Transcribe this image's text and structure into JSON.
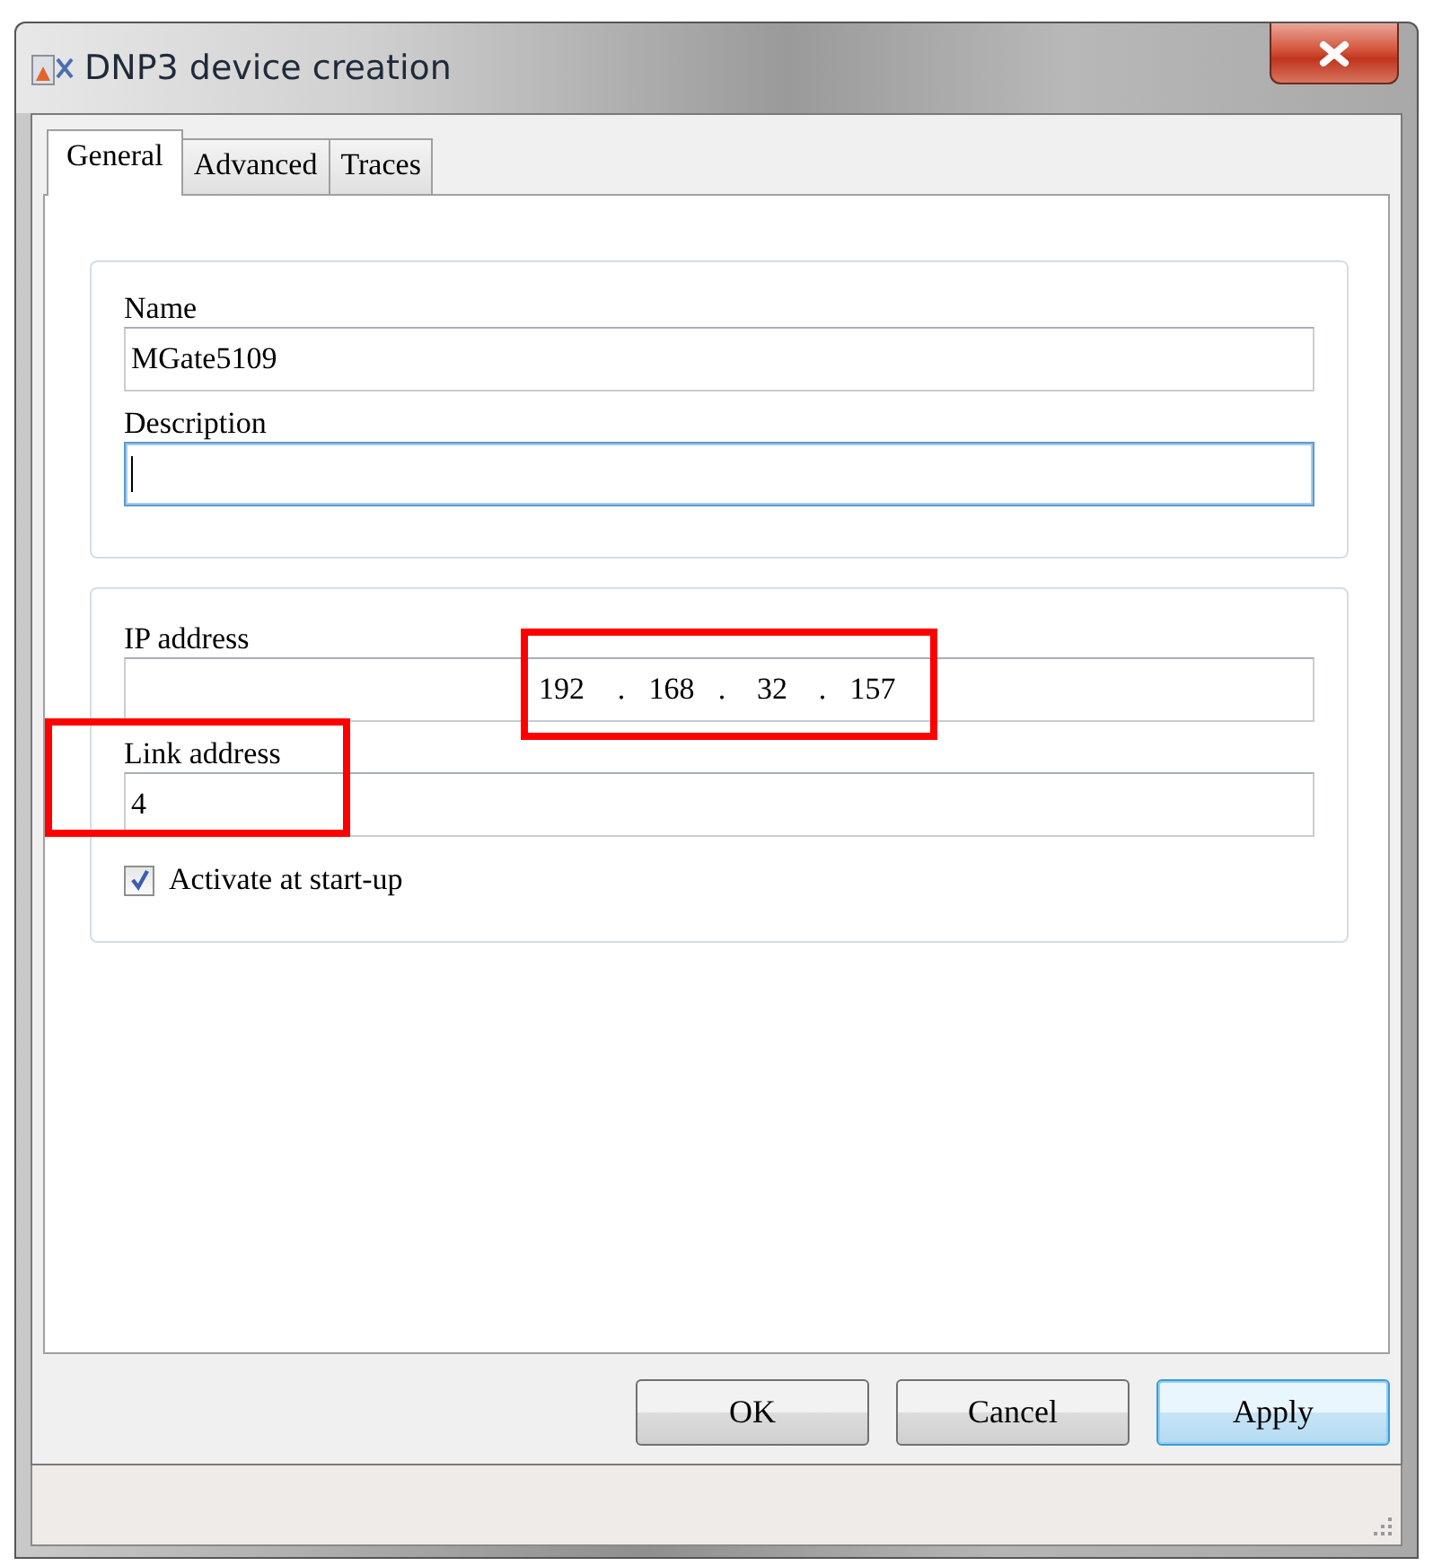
{
  "window": {
    "title": "DNP3 device creation"
  },
  "tabs": [
    {
      "label": "General",
      "selected": true
    },
    {
      "label": "Advanced",
      "selected": false
    },
    {
      "label": "Traces",
      "selected": false
    }
  ],
  "general_group": {
    "name": {
      "label": "Name",
      "value": "MGate5109",
      "focused": false
    },
    "description": {
      "label": "Description",
      "focused": true
    }
  },
  "connection_group": {
    "ip_address": {
      "label": "IP address",
      "octets": [
        "192",
        "168",
        "32",
        "157"
      ],
      "separator": ".",
      "highlighted": true
    },
    "link_address": {
      "label": "Link address",
      "value": "4",
      "highlighted": true
    },
    "activate": {
      "label": "Activate at start-up",
      "checked": true
    }
  },
  "buttons": [
    {
      "label": "OK",
      "default": false
    },
    {
      "label": "Cancel",
      "default": false
    },
    {
      "label": "Apply",
      "default": true
    }
  ]
}
